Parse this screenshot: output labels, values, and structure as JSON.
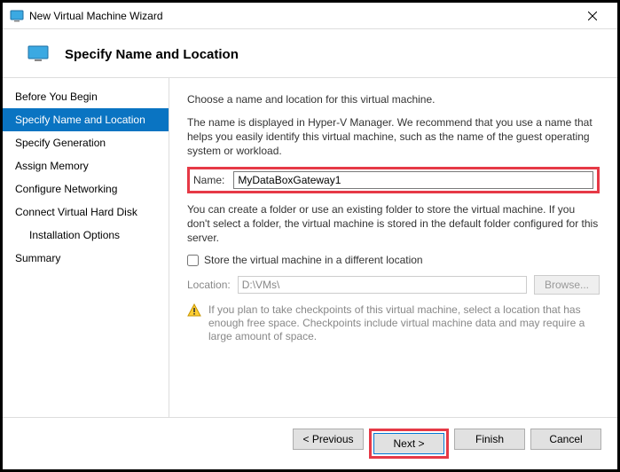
{
  "window": {
    "title": "New Virtual Machine Wizard"
  },
  "header": {
    "title": "Specify Name and Location"
  },
  "sidebar": {
    "items": [
      {
        "label": "Before You Begin"
      },
      {
        "label": "Specify Name and Location"
      },
      {
        "label": "Specify Generation"
      },
      {
        "label": "Assign Memory"
      },
      {
        "label": "Configure Networking"
      },
      {
        "label": "Connect Virtual Hard Disk"
      },
      {
        "label": "Installation Options"
      },
      {
        "label": "Summary"
      }
    ],
    "active_index": 1
  },
  "content": {
    "intro": "Choose a name and location for this virtual machine.",
    "description": "The name is displayed in Hyper-V Manager. We recommend that you use a name that helps you easily identify this virtual machine, such as the name of the guest operating system or workload.",
    "name_label": "Name:",
    "name_value": "MyDataBoxGateway1",
    "folder_text": "You can create a folder or use an existing folder to store the virtual machine. If you don't select a folder, the virtual machine is stored in the default folder configured for this server.",
    "store_checkbox_label": "Store the virtual machine in a different location",
    "store_checked": false,
    "location_label": "Location:",
    "location_value": "D:\\VMs\\",
    "browse_label": "Browse...",
    "warning": "If you plan to take checkpoints of this virtual machine, select a location that has enough free space. Checkpoints include virtual machine data and may require a large amount of space."
  },
  "footer": {
    "previous": "< Previous",
    "next": "Next >",
    "finish": "Finish",
    "cancel": "Cancel"
  }
}
